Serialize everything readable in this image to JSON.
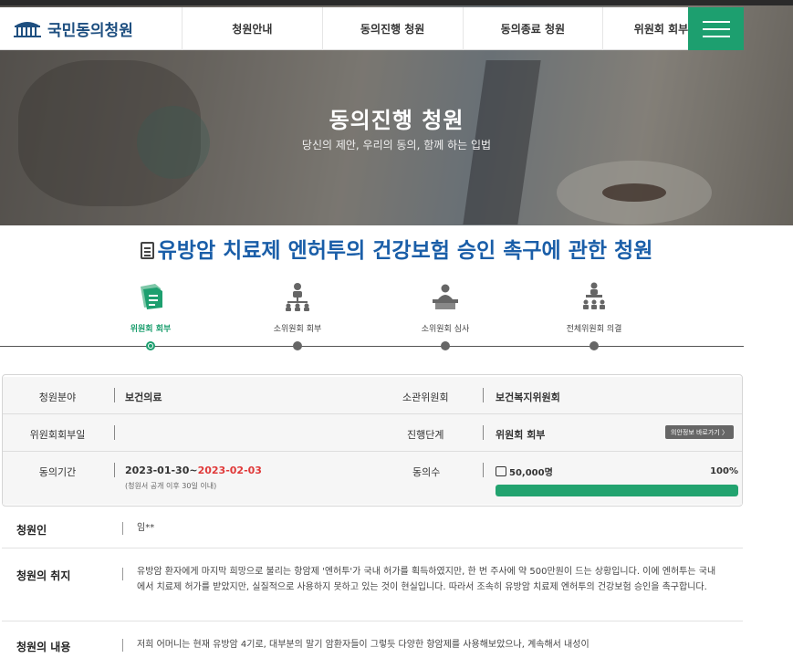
{
  "nav": {
    "logo_text": "국민동의청원",
    "items": [
      "청원안내",
      "동의진행 청원",
      "동의종료 청원",
      "위원회 회부 청원"
    ]
  },
  "hero": {
    "title": "동의진행 청원",
    "subtitle": "당신의 제안, 우리의 동의, 함께 하는 입법"
  },
  "petition": {
    "title": "유방암 치료제 엔허투의 건강보험 승인 촉구에 관한 청원"
  },
  "steps": [
    {
      "label": "위원회 회부",
      "icon": "documents-icon",
      "active": true
    },
    {
      "label": "소위원회 회부",
      "icon": "org-chart-icon",
      "active": false
    },
    {
      "label": "소위원회 심사",
      "icon": "meeting-icon",
      "active": false
    },
    {
      "label": "전체위원회 의결",
      "icon": "assembly-icon",
      "active": false
    }
  ],
  "info": {
    "field_label": "청원분야",
    "field_value": "보건의료",
    "committee_label": "소관위원회",
    "committee_value": "보건복지위원회",
    "referral_date_label": "위원회회부일",
    "referral_date_value": "",
    "stage_label": "진행단계",
    "stage_value": "위원회 회부",
    "view_button": "의안정보 바로가기 〉",
    "period_label": "동의기간",
    "period_start": "2023-01-30~",
    "period_end": "2023-02-03",
    "period_note": "(청원서 공개 이후 30일 이내)",
    "count_label": "동의수",
    "count_value": "50,000명",
    "percent_text": "100%",
    "percent": 1.0
  },
  "details": {
    "petitioner_label": "청원인",
    "petitioner_value": "임**",
    "purpose_label": "청원의 취지",
    "purpose_text": "유방암 환자에게 마지막 희망으로 불리는 항암제 '엔허투'가 국내 허가를 획득하였지만, 한 번 주사에 약 500만원이 드는 상황입니다. 이에 엔허투는 국내에서 치료제 허가를 받았지만, 실질적으로 사용하지 못하고 있는 것이 현실입니다. 따라서 조속히 유방암 치료제 엔허투의 건강보험 승인을 촉구합니다.",
    "content_label": "청원의 내용",
    "content_text": "저희 어머니는 현재 유방암 4기로, 대부분의 말기 암환자들이 그렇듯 다양한 항암제를 사용해보았으나, 계속해서 내성이"
  },
  "colors": {
    "accent": "#1d9f6f",
    "title_blue": "#1a5ea8",
    "date_red": "#e03a3a"
  }
}
